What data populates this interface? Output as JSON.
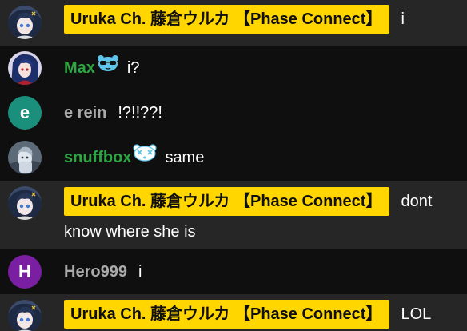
{
  "messages": [
    {
      "type": "owner",
      "author": "Uruka Ch. 藤倉ウルカ 【Phase Connect】",
      "text": "i"
    },
    {
      "type": "member",
      "author": "Max",
      "badge": "sunglasses-bear-icon",
      "text": "i?"
    },
    {
      "type": "normal",
      "author": "e rein",
      "avatar_letter": "e",
      "avatar_color": "#1a8f7c",
      "text": "!?!!??!"
    },
    {
      "type": "member",
      "author": "snuffbox",
      "badge": "dizzy-bear-icon",
      "text": "same"
    },
    {
      "type": "owner",
      "author": "Uruka Ch. 藤倉ウルカ 【Phase Connect】",
      "text": "dont know where she is"
    },
    {
      "type": "normal",
      "author": "Hero999",
      "avatar_letter": "H",
      "avatar_color": "#7b1fa2",
      "text": "i"
    },
    {
      "type": "owner",
      "author": "Uruka Ch. 藤倉ウルカ 【Phase Connect】",
      "text": "LOL"
    }
  ],
  "colors": {
    "owner_badge_bg": "#ffd600",
    "member_name": "#2ba640",
    "normal_name": "#aaaaaa",
    "owner_row_bg": "#262626",
    "plain_row_bg": "#0f0f0f"
  }
}
